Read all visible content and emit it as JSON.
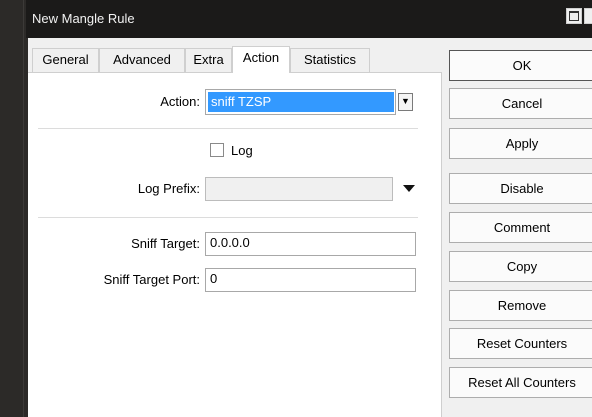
{
  "window": {
    "title": "New Mangle Rule"
  },
  "tabs": [
    {
      "label": "General"
    },
    {
      "label": "Advanced"
    },
    {
      "label": "Extra"
    },
    {
      "label": "Action"
    },
    {
      "label": "Statistics"
    }
  ],
  "active_tab": "Action",
  "form": {
    "action_label": "Action:",
    "action_value": "sniff TZSP",
    "log_label": "Log",
    "log_checked": false,
    "log_prefix_label": "Log Prefix:",
    "log_prefix_value": "",
    "sniff_target_label": "Sniff Target:",
    "sniff_target_value": "0.0.0.0",
    "sniff_target_port_label": "Sniff Target Port:",
    "sniff_target_port_value": "0"
  },
  "buttons": {
    "ok": "OK",
    "cancel": "Cancel",
    "apply": "Apply",
    "disable": "Disable",
    "comment": "Comment",
    "copy": "Copy",
    "remove": "Remove",
    "reset_counters": "Reset Counters",
    "reset_all_counters": "Reset All Counters"
  },
  "colors": {
    "selection": "#3399ff",
    "titlebar": "#1b1a19"
  }
}
